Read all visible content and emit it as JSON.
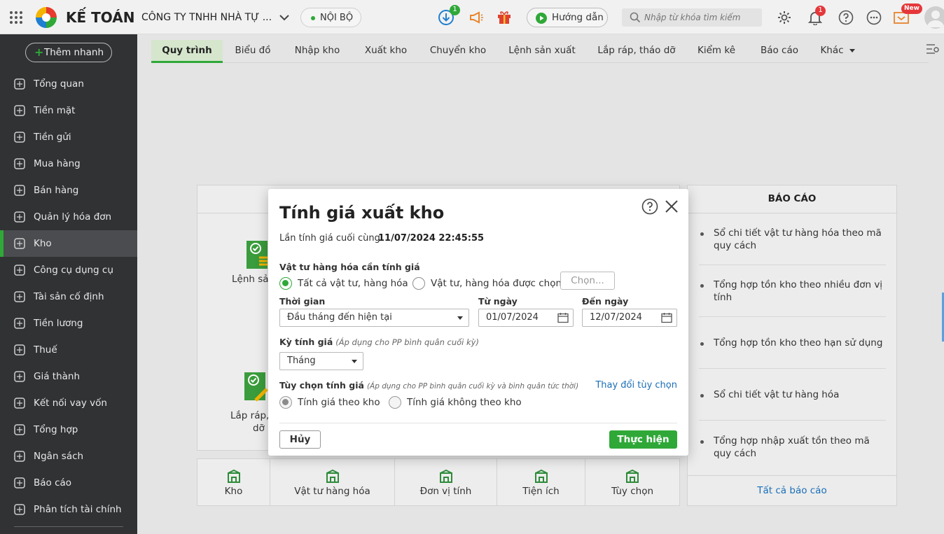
{
  "app": {
    "logo_text": "KẾ TOÁN",
    "company": "CÔNG TY TNHH NHÀ TỰ ...",
    "scope": "NỘI BỘ"
  },
  "topbar": {
    "download_badge": "1",
    "guide_label": "Hướng dẫn",
    "search_placeholder": "Nhập từ khóa tìm kiếm",
    "notify_badge": "1",
    "new_badge": "New"
  },
  "sidebar": {
    "quick_add": "Thêm nhanh",
    "items": [
      {
        "label": "Tổng quan",
        "icon": "pie-chart-icon"
      },
      {
        "label": "Tiền mặt",
        "icon": "money-bag-icon"
      },
      {
        "label": "Tiền gửi",
        "icon": "bank-icon"
      },
      {
        "label": "Mua hàng",
        "icon": "shopping-bag-icon"
      },
      {
        "label": "Bán hàng",
        "icon": "cart-icon"
      },
      {
        "label": "Quản lý hóa đơn",
        "icon": "invoice-icon"
      },
      {
        "label": "Kho",
        "icon": "warehouse-icon"
      },
      {
        "label": "Công cụ dụng cụ",
        "icon": "tools-icon"
      },
      {
        "label": "Tài sản cố định",
        "icon": "car-icon"
      },
      {
        "label": "Tiền lương",
        "icon": "payroll-icon"
      },
      {
        "label": "Thuế",
        "icon": "tax-icon"
      },
      {
        "label": "Giá thành",
        "icon": "price-tag-icon"
      },
      {
        "label": "Kết nối vay vốn",
        "icon": "loan-icon"
      },
      {
        "label": "Tổng hợp",
        "icon": "ledger-icon"
      },
      {
        "label": "Ngân sách",
        "icon": "budget-icon"
      },
      {
        "label": "Báo cáo",
        "icon": "bar-chart-icon"
      },
      {
        "label": "Phân tích tài chính",
        "icon": "analytics-icon"
      }
    ],
    "active": "Kho"
  },
  "tabs": [
    "Quy trình",
    "Biểu đồ",
    "Nhập kho",
    "Xuất kho",
    "Chuyển kho",
    "Lệnh sản xuất",
    "Lắp ráp, tháo dỡ",
    "Kiểm kê",
    "Báo cáo",
    "Khác"
  ],
  "background": {
    "card1_label": "Lệnh sản",
    "card2_label_1": "Lắp ráp, t",
    "card2_label_2": "dỡ",
    "tools": [
      "Kho",
      "Vật tư hàng hóa",
      "Đơn vị tính",
      "Tiện ích",
      "Tùy chọn"
    ],
    "reports_title": "BÁO CÁO",
    "reports": [
      "Sổ chi tiết vật tư hàng hóa theo mã quy cách",
      "Tổng hợp tồn kho theo nhiều đơn vị tính",
      "Tổng hợp tồn kho theo hạn sử dụng",
      "Sổ chi tiết vật tư hàng hóa",
      "Tổng hợp nhập xuất tồn theo mã quy cách"
    ],
    "all_reports": "Tất cả báo cáo"
  },
  "dialog": {
    "title": "Tính giá xuất kho",
    "last_calc_label": "Lần tính giá cuối cùng:",
    "last_calc_value": "11/07/2024 22:45:55",
    "items_section": "Vật tư hàng hóa cần tính giá",
    "opt_all": "Tất cả vật tư, hàng hóa",
    "opt_selected": "Vật tư, hàng hóa được chọn",
    "choose_btn": "Chọn...",
    "period_label": "Thời gian",
    "period_value": "Đầu tháng đến hiện tại",
    "from_label": "Từ ngày",
    "from_value": "01/07/2024",
    "to_label": "Đến ngày",
    "to_value": "12/07/2024",
    "cycle_label": "Kỳ tính giá",
    "cycle_note": "(Áp dụng cho PP bình quân cuối kỳ)",
    "cycle_value": "Tháng",
    "option_label": "Tùy chọn tính giá",
    "option_note": "(Áp dụng cho PP bình quân cuối kỳ và bình quân tức thời)",
    "change_option": "Thay đổi tùy chọn",
    "by_warehouse": "Tính giá theo kho",
    "not_by_warehouse": "Tính giá không theo kho",
    "cancel": "Hủy",
    "execute": "Thực hiện",
    "accent": "#2fa838"
  }
}
